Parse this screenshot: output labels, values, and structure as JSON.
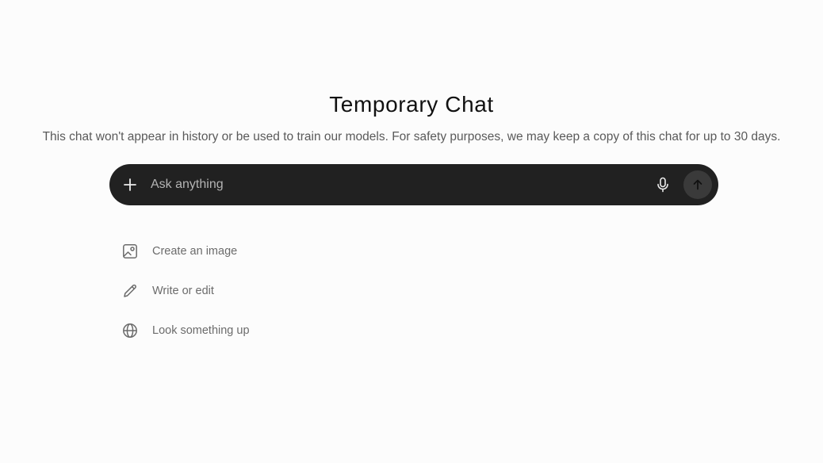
{
  "header": {
    "title": "Temporary Chat",
    "subtitle": "This chat won't appear in history or be used to train our models. For safety purposes, we may keep a copy of this chat for up to 30 days."
  },
  "composer": {
    "placeholder": "Ask anything",
    "value": "",
    "plus_icon": "plus-icon",
    "mic_icon": "microphone-icon",
    "send_icon": "arrow-up-icon"
  },
  "suggestions": [
    {
      "label": "Create an image",
      "icon": "image-icon"
    },
    {
      "label": "Write or edit",
      "icon": "pencil-icon"
    },
    {
      "label": "Look something up",
      "icon": "globe-icon"
    }
  ],
  "colors": {
    "background": "#fcfcfc",
    "composer": "#212121",
    "send_button": "#3a3a3a"
  }
}
